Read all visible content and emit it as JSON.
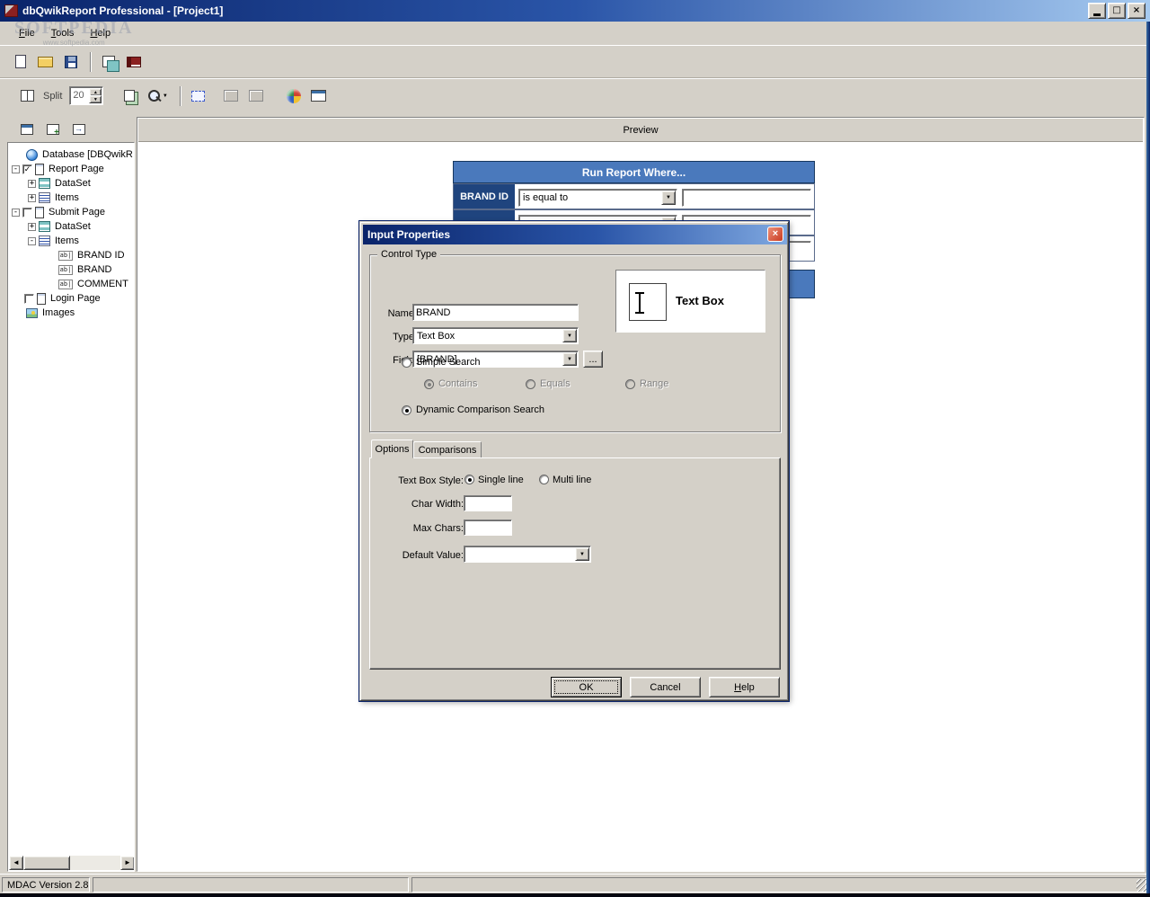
{
  "icons": {
    "minimize": "▁",
    "maximize": "□",
    "close": "×",
    "dropdown": "▼",
    "spin_up": "▲",
    "spin_down": "▼",
    "scroll_left": "◄",
    "scroll_right": "►",
    "plus": "+",
    "minus": "-",
    "check": "✓",
    "textbox_field": "ab|"
  },
  "window": {
    "title": "dbQwikReport Professional - [Project1]"
  },
  "menu": {
    "items": [
      {
        "label": "File"
      },
      {
        "label": "Tools"
      },
      {
        "label": "Help"
      }
    ]
  },
  "watermark": {
    "title": "SOFTPEDIA",
    "subtitle": "www.softpedia.com"
  },
  "toolbar": {
    "split_label": "Split",
    "split_value": "20"
  },
  "sidebar": {
    "tree": [
      {
        "label": "Database [DBQwikR"
      },
      {
        "label": "Report Page"
      },
      {
        "label": "DataSet"
      },
      {
        "label": "Items"
      },
      {
        "label": "Submit Page"
      },
      {
        "label": "DataSet"
      },
      {
        "label": "Items"
      },
      {
        "label": "BRAND ID"
      },
      {
        "label": "BRAND"
      },
      {
        "label": "COMMENT"
      },
      {
        "label": "Login Page"
      },
      {
        "label": "Images"
      }
    ]
  },
  "preview": {
    "header": "Preview",
    "table": {
      "title": "Run Report Where...",
      "row1_label": "BRAND ID",
      "row1_operator": "is equal to"
    }
  },
  "dialog": {
    "title": "Input Properties",
    "group_label": "Control Type",
    "name_label": "Name:",
    "name_value": "BRAND",
    "type_label": "Type:",
    "type_value": "Text Box",
    "field_label": "Field:",
    "field_value": "[BRAND]",
    "browse_label": "...",
    "preview_caption": "Text Box",
    "simple_search_label": "Simple Search",
    "contains_label": "Contains",
    "equals_label": "Equals",
    "range_label": "Range",
    "dynamic_label": "Dynamic Comparison Search",
    "tabs": [
      {
        "label": "Options"
      },
      {
        "label": "Comparisons"
      }
    ],
    "options": {
      "style_label": "Text Box Style:",
      "single_label": "Single line",
      "multi_label": "Multi line",
      "char_width_label": "Char Width:",
      "char_width_value": "",
      "max_chars_label": "Max Chars:",
      "max_chars_value": "",
      "default_label": "Default Value:",
      "default_value": ""
    },
    "buttons": {
      "ok": "OK",
      "cancel": "Cancel",
      "help": "Help"
    }
  },
  "statusbar": {
    "left": "MDAC Version 2.8"
  }
}
